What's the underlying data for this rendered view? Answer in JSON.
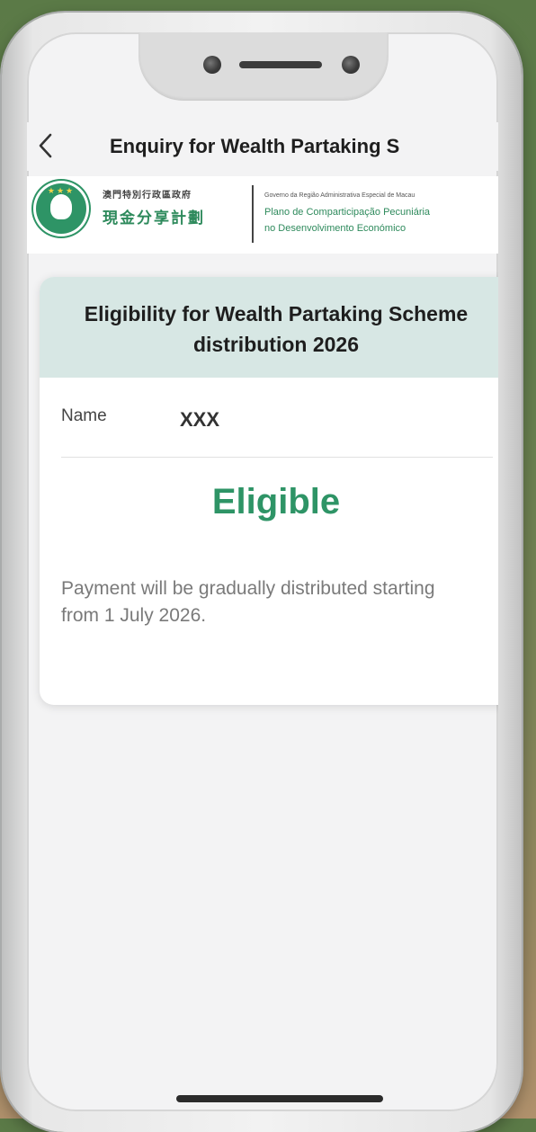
{
  "nav": {
    "back_label": "<",
    "title": "Enquiry for Wealth Partaking S"
  },
  "banner": {
    "emblem_icon": "macao-emblem-icon",
    "cn_top": "澳門特別行政區政府",
    "cn_main": "現金分享計劃",
    "pt_gov": "Governo da Região Administrativa Especial de Macau",
    "pt_line1": "Plano de Comparticipação Pecuniária",
    "pt_line2": "no Desenvolvimento Económico"
  },
  "card": {
    "title": "Eligibility for Wealth Partaking Scheme distribution 2026",
    "name_label": "Name",
    "name_value": "XXX",
    "status": "Eligible",
    "note": "Payment will be gradually distributed starting from 1 July 2026."
  },
  "colors": {
    "accent": "#2e9466",
    "header_bg": "#d7e7e4",
    "screen_bg": "#f3f3f4"
  }
}
